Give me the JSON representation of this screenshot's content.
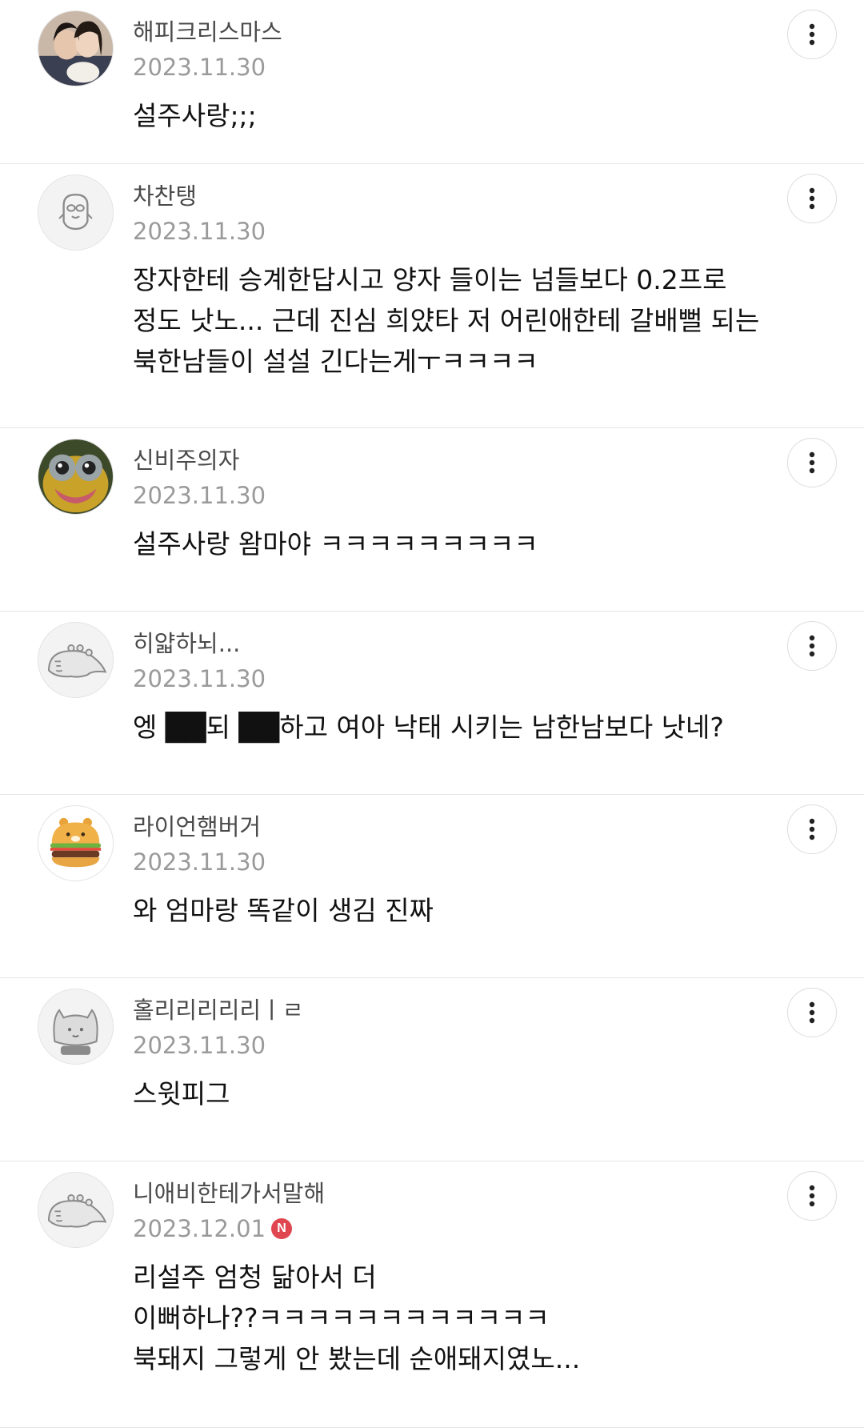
{
  "comments": [
    {
      "nickname": "해피크리스마스",
      "date": "2023.11.30",
      "lines": [
        "설주사랑;;;"
      ],
      "avatar": "photo-two-women-avatar"
    },
    {
      "nickname": "차찬탱",
      "date": "2023.11.30",
      "lines": [
        "장자한테 승계한답시고 양자 들이는 넘들보다 0.2프로",
        "정도 낫노... 근데 진심 희얐타 저 어린애한테 갈배뻘 되는",
        "북한남들이 설설 긴다는게ㅜㅋㅋㅋㅋ"
      ],
      "avatar": "default-character-avatar"
    },
    {
      "nickname": "신비주의자",
      "date": "2023.11.30",
      "lines": [
        "설주사랑 왐마야 ㅋㅋㅋㅋㅋㅋㅋㅋㅋ"
      ],
      "avatar": "cartoon-face-avatar"
    },
    {
      "nickname": "히얇하뇌...",
      "date": "2023.11.30",
      "lines": [
        "엥 ██되 ██하고 여아 낙태 시키는 남한남보다 낫네?"
      ],
      "avatar": "default-dino-avatar"
    },
    {
      "nickname": "라이언햄버거",
      "date": "2023.11.30",
      "lines": [
        "와 엄마랑 똑같이 생김 진짜"
      ],
      "avatar": "lion-burger-avatar"
    },
    {
      "nickname": "홀리리리리리ㅣㄹ",
      "date": "2023.11.30",
      "lines": [
        "스윗피그"
      ],
      "avatar": "default-cat-avatar"
    },
    {
      "nickname": "니애비한테가서말해",
      "date": "2023.12.01",
      "badge": "N",
      "lines": [
        "리설주 엄청 닮아서 더",
        "이뻐하나??ㅋㅋㅋㅋㅋㅋㅋㅋㅋㅋㅋㅋ",
        "북돼지 그렇게 안 봤는데 순애돼지였노..."
      ],
      "avatar": "default-dino-avatar"
    }
  ],
  "colors": {
    "nickname": "#4a4a4a",
    "date": "#9a9a9a",
    "text": "#111111",
    "divider": "#e6e6e6",
    "badge": "#e0464f"
  }
}
